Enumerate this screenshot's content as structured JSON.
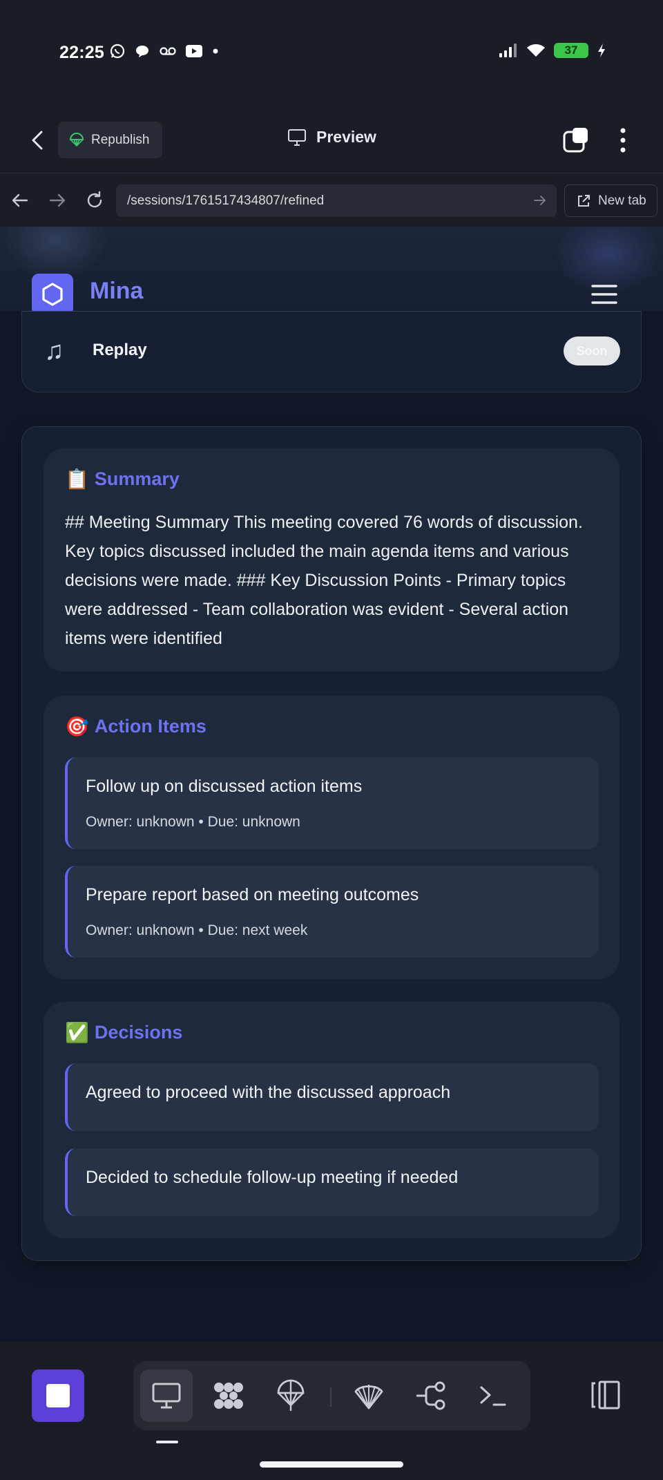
{
  "status_bar": {
    "time": "22:25",
    "battery": "37",
    "left_icons": [
      "whatsapp-icon",
      "chat-bubble-icon",
      "voicemail-icon",
      "youtube-icon",
      "dot-icon"
    ],
    "right_icons": [
      "signal-icon",
      "wifi-icon",
      "battery-icon",
      "charging-icon"
    ]
  },
  "app_bar": {
    "republish_label": "Republish",
    "preview_label": "Preview"
  },
  "url_bar": {
    "url": "/sessions/1761517434807/refined",
    "new_tab_label": "New tab"
  },
  "site": {
    "brand": "Mina",
    "brand_color": "#6366f1",
    "replay_label": "Replay",
    "replay_badge": "Soon"
  },
  "summary": {
    "emoji": "📋",
    "title": "Summary",
    "text": "## Meeting Summary This meeting covered 76 words of discussion. Key topics discussed included the main agenda items and various decisions were made. ### Key Discussion Points - Primary topics were addressed - Team collaboration was evident - Several action items were identified"
  },
  "action_items": {
    "emoji": "🎯",
    "title": "Action Items",
    "items": [
      {
        "title": "Follow up on discussed action items",
        "meta": "Owner: unknown • Due: unknown"
      },
      {
        "title": "Prepare report based on meeting outcomes",
        "meta": "Owner: unknown • Due: next week"
      }
    ]
  },
  "decisions": {
    "emoji": "✅",
    "title": "Decisions",
    "items": [
      {
        "title": "Agreed to proceed with the discussed approach"
      },
      {
        "title": "Decided to schedule follow-up meeting if needed"
      }
    ]
  },
  "toolbar": {
    "tools": [
      "monitor-icon",
      "grid-icon",
      "parachute-icon",
      "shell-icon",
      "share-nodes-icon",
      "terminal-icon"
    ],
    "active_tool": "monitor-icon"
  }
}
